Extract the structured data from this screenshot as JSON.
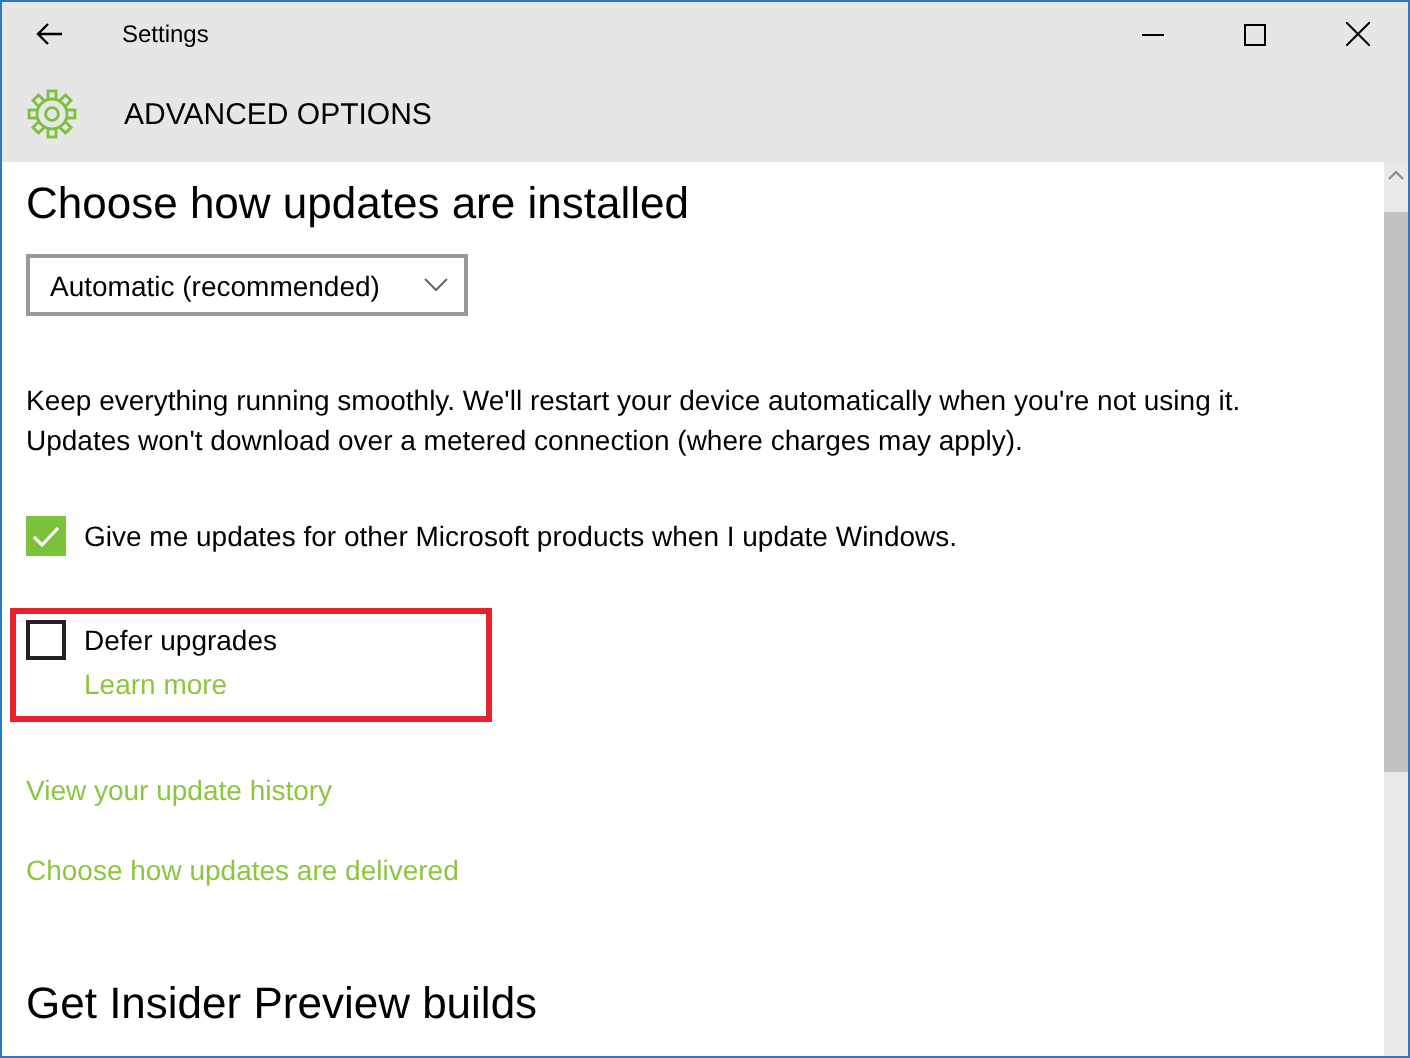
{
  "window": {
    "title": "Settings"
  },
  "page": {
    "title": "ADVANCED OPTIONS"
  },
  "section_heading": "Choose how updates are installed",
  "dropdown": {
    "value": "Automatic (recommended)"
  },
  "description": "Keep everything running smoothly. We'll restart your device automatically when you're not using it. Updates won't download over a metered connection (where charges may apply).",
  "options": [
    {
      "label": "Give me updates for other Microsoft products when I update Windows.",
      "checked": true,
      "highlighted": false
    },
    {
      "label": "Defer upgrades",
      "checked": false,
      "highlighted": true,
      "link": "Learn more"
    }
  ],
  "links": [
    "View your update history",
    "Choose how updates are delivered"
  ],
  "next_heading": "Get Insider Preview builds"
}
